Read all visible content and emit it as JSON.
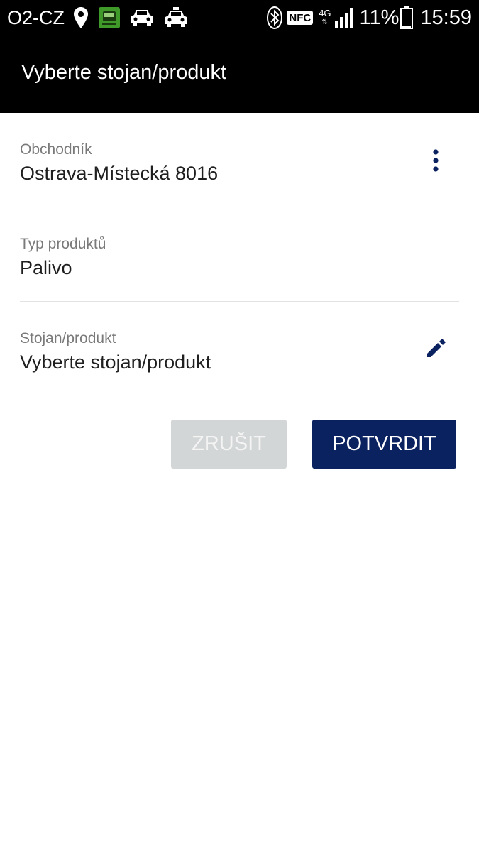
{
  "status_bar": {
    "carrier": "O2-CZ",
    "icons_left": [
      "location-pin-icon",
      "app-bus-icon",
      "car-icon",
      "taxi-icon"
    ],
    "icons_right": [
      "bluetooth-icon",
      "nfc-icon",
      "signal-4g-icon",
      "battery-icon"
    ],
    "nfc_label": "NFC",
    "network_label": "4G",
    "battery": "11%",
    "time": "15:59"
  },
  "app_bar": {
    "title": "Vyberte stojan/produkt"
  },
  "fields": {
    "merchant": {
      "label": "Obchodník",
      "value": "Ostrava-Místecká 8016"
    },
    "product_type": {
      "label": "Typ produktů",
      "value": "Palivo"
    },
    "pump_product": {
      "label": "Stojan/produkt",
      "value": "Vyberte stojan/produkt"
    }
  },
  "actions": {
    "cancel_label": "ZRUŠIT",
    "confirm_label": "POTVRDIT"
  },
  "colors": {
    "app_bar_bg": "#000000",
    "confirm_bg": "#0b2260",
    "cancel_bg": "#d3d6d6",
    "icon_color": "#0b2260"
  }
}
